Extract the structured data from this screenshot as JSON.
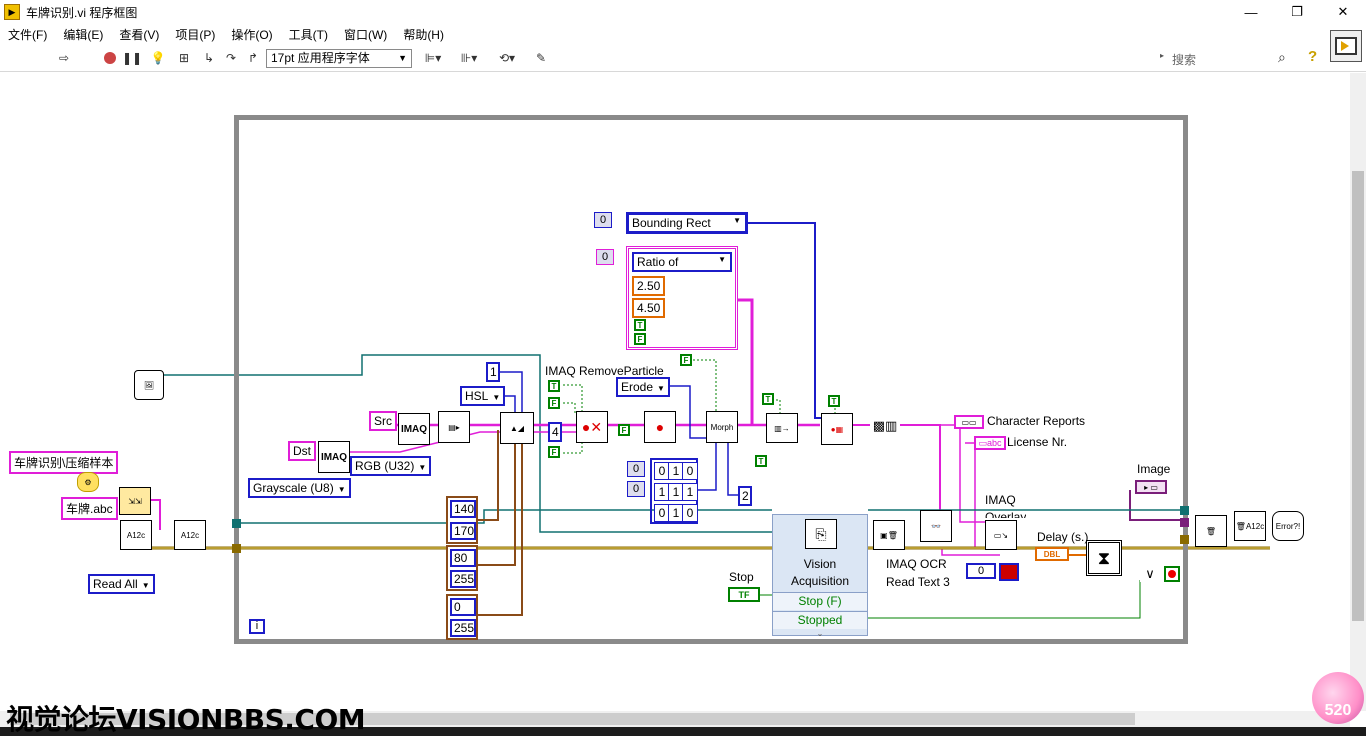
{
  "window": {
    "title": "车牌识别.vi 程序框图",
    "controls": {
      "minimize": "—",
      "maximize": "❐",
      "close": "✕"
    }
  },
  "menu": [
    "文件(F)",
    "编辑(E)",
    "查看(V)",
    "项目(P)",
    "操作(O)",
    "工具(T)",
    "窗口(W)",
    "帮助(H)"
  ],
  "toolbar": {
    "font": "17pt 应用程序字体",
    "search_placeholder": "搜索",
    "help": "?"
  },
  "diagram": {
    "path_constant": "车牌识别\\压缩样本",
    "file_constant": "车牌.abc",
    "read_mode": "Read All",
    "src_name": "Src",
    "dst_name": "Dst",
    "image_type_gray": "Grayscale (U8)",
    "image_type_rgb": "RGB (U32)",
    "color_mode": "HSL",
    "num_one": "1",
    "range1_low": "140",
    "range1_high": "170",
    "range2_low": "80",
    "range2_high": "255",
    "range3_low": "0",
    "range3_high": "255",
    "remove_particle_label": "IMAQ RemoveParticle",
    "erode": "Erode",
    "four": "4",
    "two": "2",
    "bounding_index": "0",
    "bounding_rect": "Bounding Rect",
    "ratio_index": "0",
    "ratio_of": "Ratio of",
    "ratio_low": "2.50",
    "ratio_high": "4.50",
    "t": "T",
    "f": "F",
    "morph": "Morph",
    "imaq": "IMAQ",
    "kernel_idx1": "0",
    "kernel_idx2": "0",
    "kernel": [
      [
        "0",
        "1",
        "0"
      ],
      [
        "1",
        "1",
        "1"
      ],
      [
        "0",
        "1",
        "0"
      ]
    ],
    "character_reports": "Character Reports",
    "license_nr": "License Nr.",
    "image_label": "Image",
    "imaq_overlay": "IMAQ",
    "overlay_partial": "Overlay",
    "delay_label": "Delay (s.)",
    "dbl": "DBL",
    "ocr_label_1": "IMAQ OCR",
    "ocr_label_2": "Read Text 3",
    "stop_label": "Stop",
    "stop_tf": "TF",
    "vision_acq_1": "Vision",
    "vision_acq_2": "Acquisition",
    "stop_f": "Stop (F)",
    "stopped": "Stopped",
    "error_zero": "0",
    "loop_iter": "i",
    "a12c": "A12c"
  },
  "watermark": "视觉论坛VISIONBBS.COM",
  "logo": "520",
  "colors": {
    "wire_pink": "#e01ed8",
    "wire_blue": "#1c1cc8",
    "wire_green": "#008000",
    "wire_teal": "#107070",
    "wire_brown": "#8a4b18",
    "wire_orange": "#e06a00",
    "loop_gray": "#8a8a8a"
  }
}
